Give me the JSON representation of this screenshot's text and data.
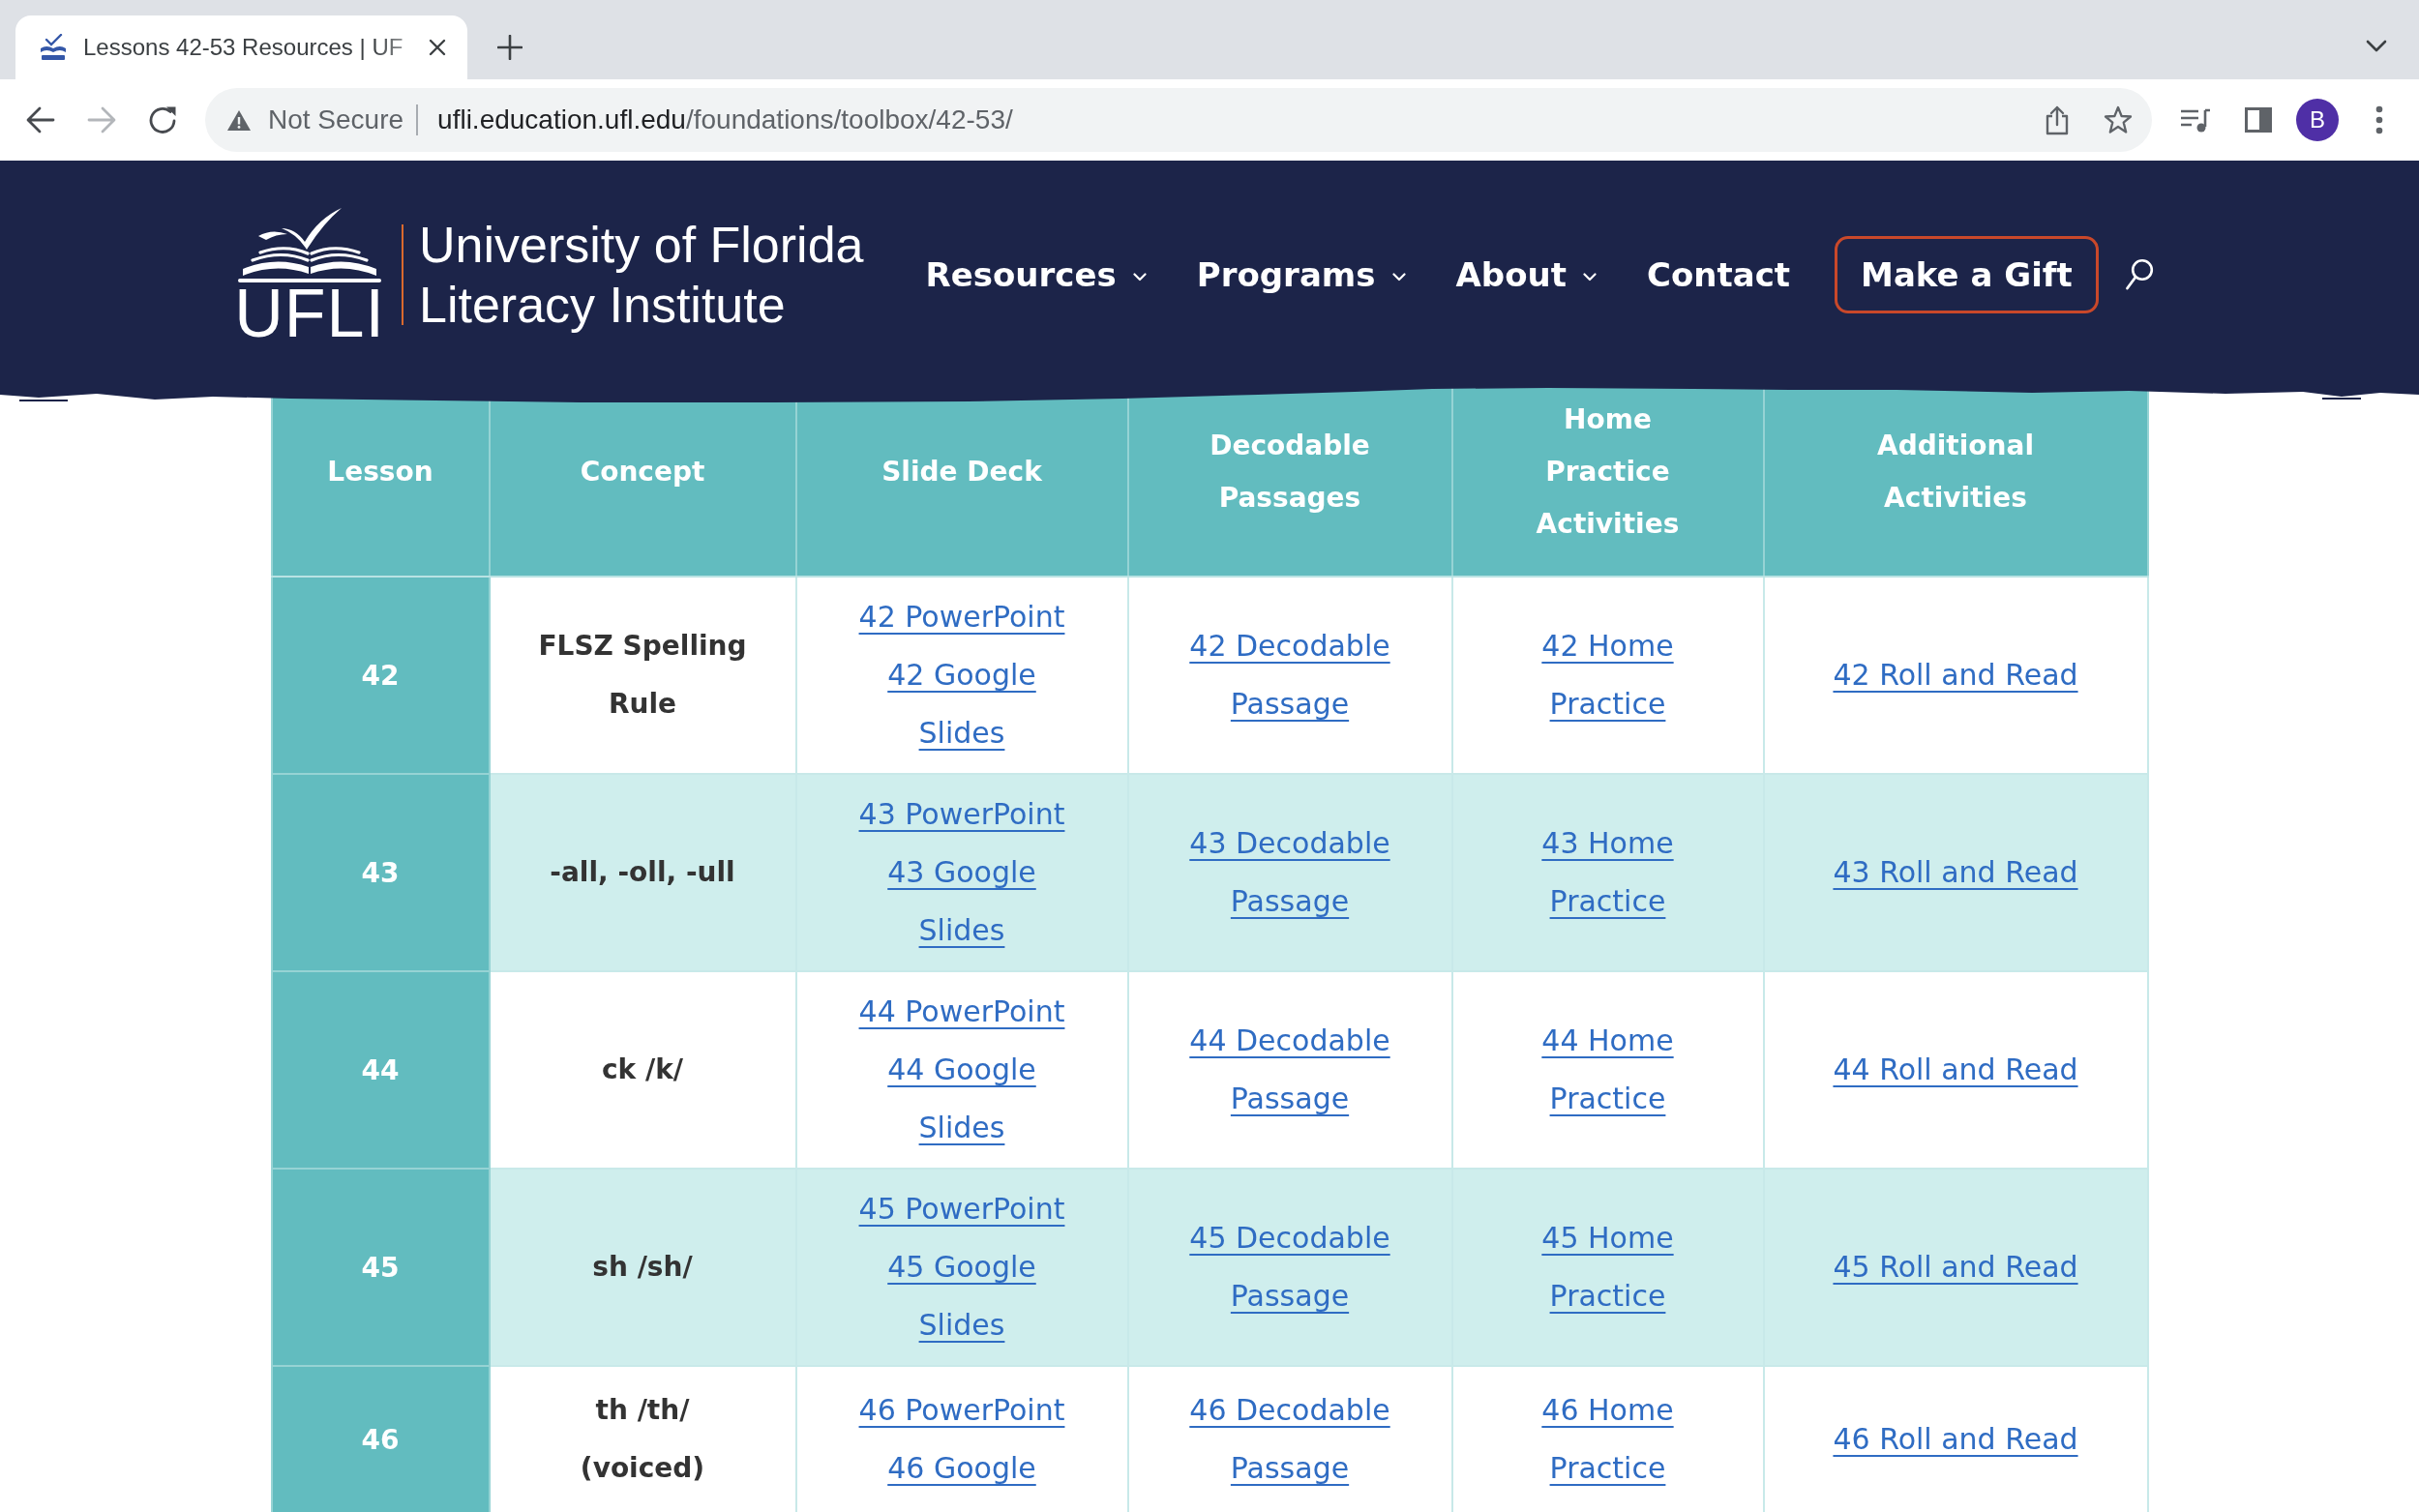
{
  "browser": {
    "tabs": [
      {
        "title": "Lessons 42-53 Resources | UF",
        "selected": true
      }
    ],
    "address_bar": {
      "security_label": "Not Secure",
      "url_host": "ufli.education.ufl.edu",
      "url_path": "/foundations/toolbox/42-53/"
    },
    "profile_avatar": "B"
  },
  "site_header": {
    "logo": {
      "abbreviation": "UFLI",
      "name_lines": [
        "University of Florida",
        "Literacy Institute"
      ]
    },
    "nav": [
      {
        "label": "Resources",
        "has_menu": true
      },
      {
        "label": "Programs",
        "has_menu": true
      },
      {
        "label": "About",
        "has_menu": true
      },
      {
        "label": "Contact",
        "has_menu": false
      }
    ],
    "gift_button": "Make a Gift"
  },
  "table": {
    "columns": [
      "Lesson",
      "Concept",
      "Slide Deck",
      "Decodable Passages",
      "Home Practice Activities",
      "Additional Activities"
    ],
    "rows": [
      {
        "lesson": "42",
        "concept": "FLSZ Spelling Rule",
        "slide_deck": [
          "42 PowerPoint",
          "42 Google Slides"
        ],
        "decodable_passages": "42 Decodable Passage",
        "home_practice": "42 Home Practice",
        "additional_activities": "42 Roll and Read"
      },
      {
        "lesson": "43",
        "concept": "-all, -oll, -ull",
        "slide_deck": [
          "43 PowerPoint",
          "43 Google Slides"
        ],
        "decodable_passages": "43 Decodable Passage",
        "home_practice": "43 Home Practice",
        "additional_activities": "43 Roll and Read"
      },
      {
        "lesson": "44",
        "concept": "ck /k/",
        "slide_deck": [
          "44 PowerPoint",
          "44 Google Slides"
        ],
        "decodable_passages": "44 Decodable Passage",
        "home_practice": "44 Home Practice",
        "additional_activities": "44 Roll and Read"
      },
      {
        "lesson": "45",
        "concept": "sh /sh/",
        "slide_deck": [
          "45 PowerPoint",
          "45 Google Slides"
        ],
        "decodable_passages": "45 Decodable Passage",
        "home_practice": "45 Home Practice",
        "additional_activities": "45 Roll and Read"
      },
      {
        "lesson": "46",
        "concept": "th /th/ (voiced)",
        "slide_deck": [
          "46 PowerPoint",
          "46 Google"
        ],
        "decodable_passages": "46 Decodable Passage",
        "home_practice": "46 Home Practice",
        "additional_activities": "46 Roll and Read"
      }
    ]
  }
}
